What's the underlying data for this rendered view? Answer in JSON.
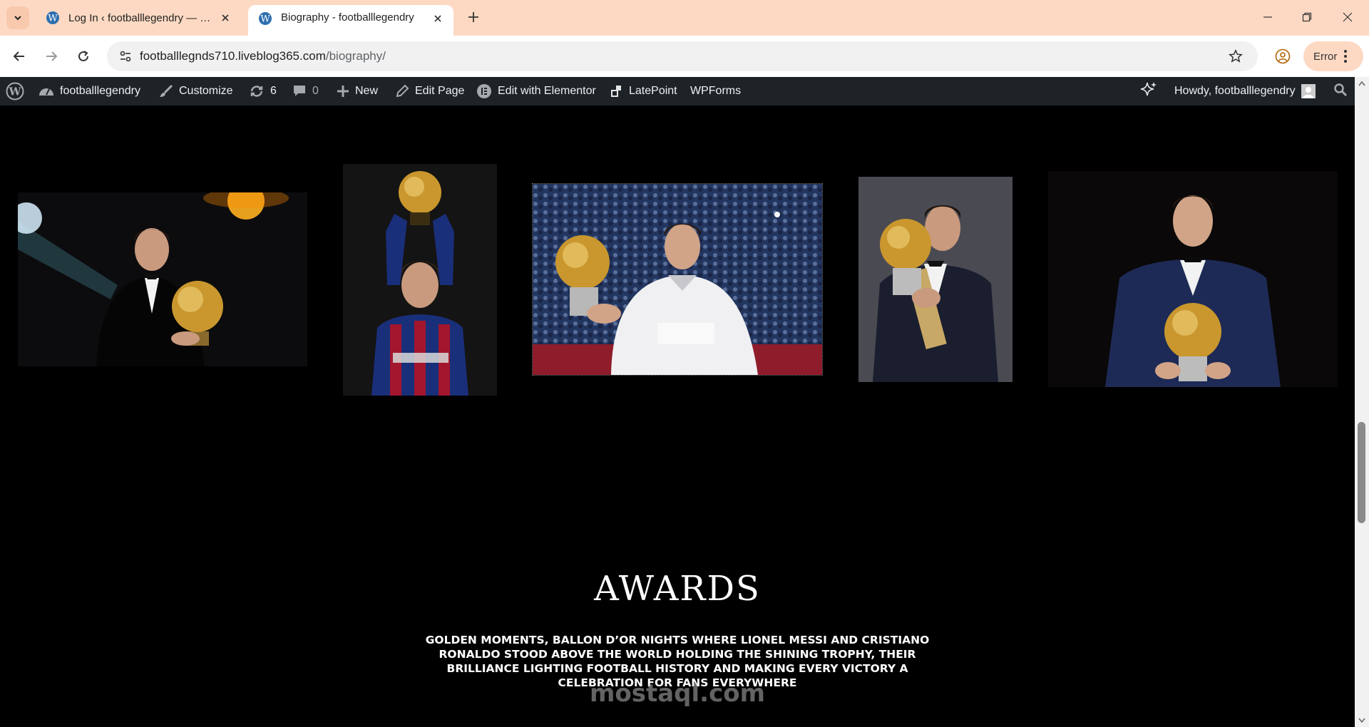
{
  "browser": {
    "tabs": [
      {
        "title": "Log In ‹ footballlegendry — WordPress",
        "active": false
      },
      {
        "title": "Biography - footballlegendry",
        "active": true
      }
    ],
    "url_host": "footballlegnds710.liveblog365.com",
    "url_path": "/biography/",
    "error_label": "Error"
  },
  "adminbar": {
    "site_name": "footballlegendry",
    "customize": "Customize",
    "updates_count": "6",
    "comments_count": "0",
    "new": "New",
    "edit_page": "Edit Page",
    "edit_elementor": "Edit with Elementor",
    "latepoint": "LatePoint",
    "wpforms": "WPForms",
    "howdy": "Howdy, footballlegendry"
  },
  "gallery": [
    {
      "alt": "Messi in tuxedo holding Ballon d'Or"
    },
    {
      "alt": "Messi in Barcelona kit raising Ballon d'Or"
    },
    {
      "alt": "Ronaldo in Real Madrid kit holding Ballon d'Or"
    },
    {
      "alt": "Ronaldo in suit holding Ballon d'Or"
    },
    {
      "alt": "Ronaldo in blue tuxedo holding Ballon d'Or"
    }
  ],
  "awards": {
    "title": "AWARDS",
    "description": "GOLDEN MOMENTS, BALLON D’OR NIGHTS WHERE LIONEL MESSI AND CRISTIANO RONALDO STOOD ABOVE THE WORLD HOLDING THE SHINING TROPHY, THEIR BRILLIANCE LIGHTING FOOTBALL HISTORY AND MAKING EVERY VICTORY A CELEBRATION FOR FANS EVERYWHERE"
  },
  "watermark": "mostaql.com",
  "colors": {
    "tabbar": "#fdd9c3",
    "adminbar": "#1d2327",
    "page_bg": "#000000",
    "gold": "#c9972e"
  }
}
